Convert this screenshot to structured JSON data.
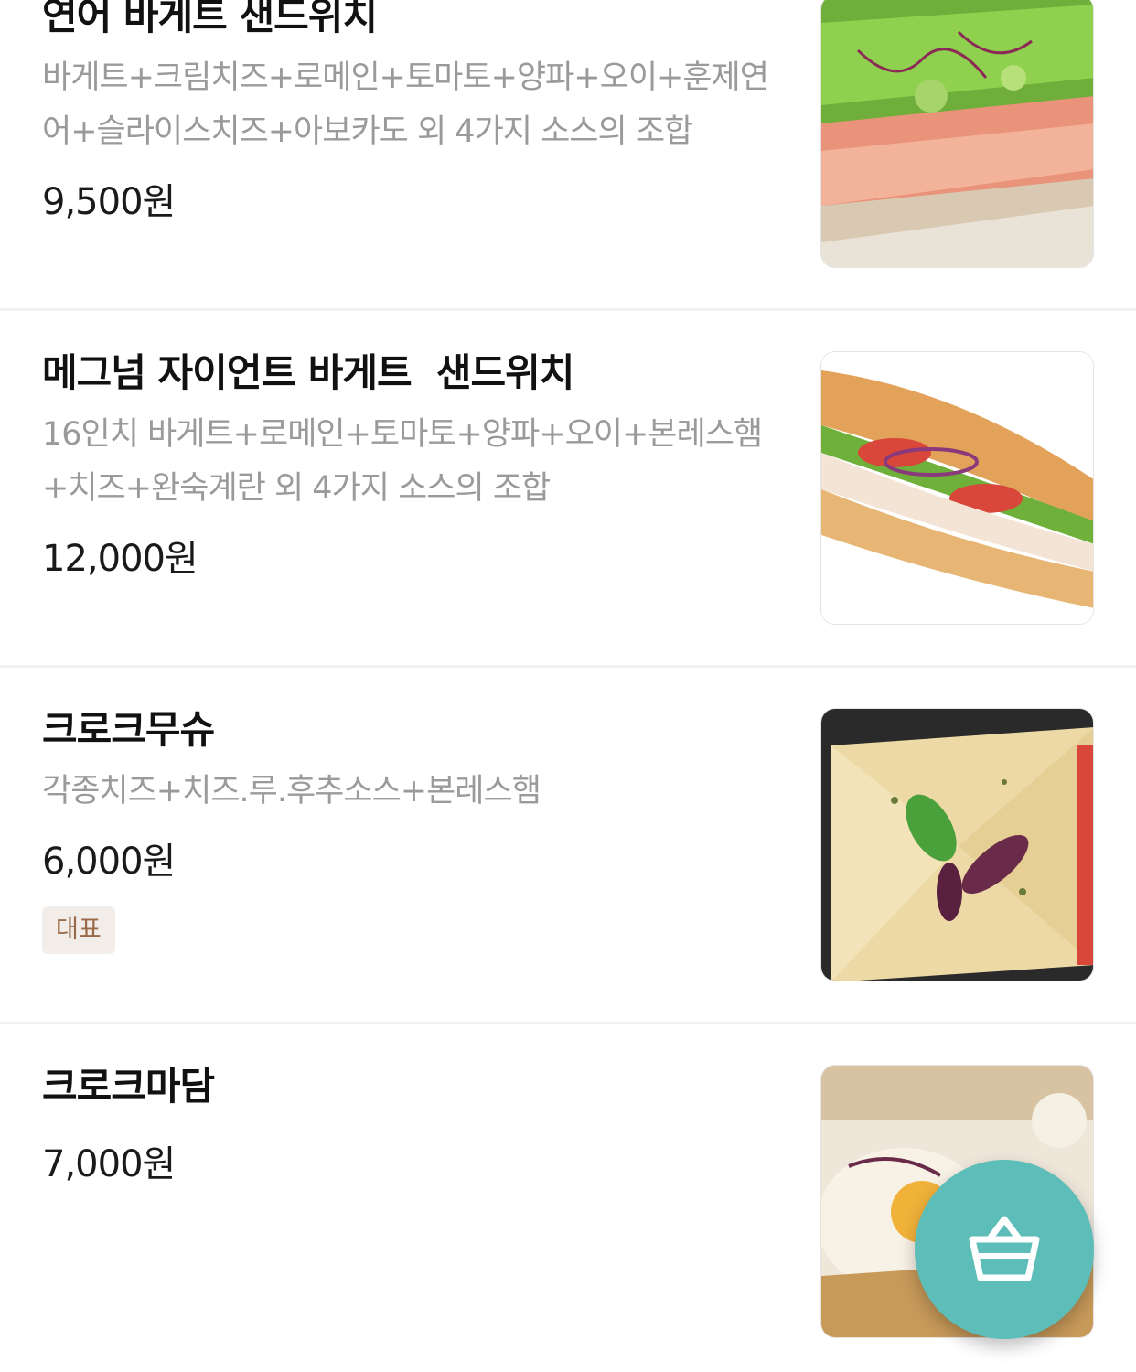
{
  "menu": {
    "items": [
      {
        "name": "연어 바게트 샌드위치",
        "description": "바게트+크림치즈+로메인+토마토+양파+오이+훈제연어+슬라이스치즈+아보카도 외 4가지 소스의 조합",
        "price": "9,500원",
        "image_icon": "salmon-baguette-photo"
      },
      {
        "name": "메그넘 자이언트 바게트  샌드위치",
        "description": "16인치 바게트+로메인+토마토+양파+오이+본레스햄+치즈+완숙계란 외 4가지 소스의 조합",
        "price": "12,000원",
        "image_icon": "giant-baguette-photo"
      },
      {
        "name": "크로크무슈",
        "description": "각종치즈+치즈.루.후추소스+본레스햄",
        "price": "6,000원",
        "badge": "대표",
        "image_icon": "croque-monsieur-photo"
      },
      {
        "name": "크로크마담",
        "price": "7,000원",
        "image_icon": "croque-madame-photo"
      }
    ]
  },
  "cart_button": {
    "icon": "shopping-basket-icon",
    "color": "#5dbdb8"
  },
  "colors": {
    "description_text": "#9a9a9a",
    "badge_bg": "#f2ede8",
    "badge_text": "#9a6a48",
    "divider": "#f1f1f1"
  }
}
